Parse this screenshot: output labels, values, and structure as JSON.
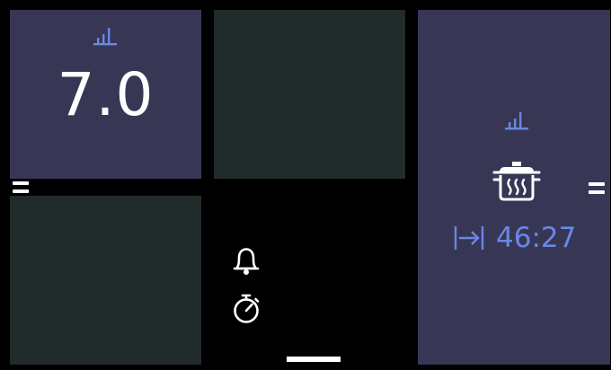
{
  "zones": {
    "top_left": {
      "power_icon": "power-level-icon",
      "power_level": "7.0"
    },
    "top_middle": {},
    "bottom_left": {},
    "right": {
      "power_icon": "power-level-icon",
      "program_icon": "cooking-pot-steam-icon",
      "timer_icon": "timer-arrow-icon",
      "timer_value": "46:27"
    }
  },
  "controls": {
    "bell_icon": "bell-icon",
    "stopwatch_icon": "stopwatch-icon",
    "left_handle_icon": "equals-handle-icon",
    "right_handle_icon": "equals-handle-icon"
  },
  "colors": {
    "background": "#000000",
    "active_zone": "#373755",
    "inactive_zone": "#212b2b",
    "accent": "#6a86e6",
    "text": "#ffffff"
  }
}
